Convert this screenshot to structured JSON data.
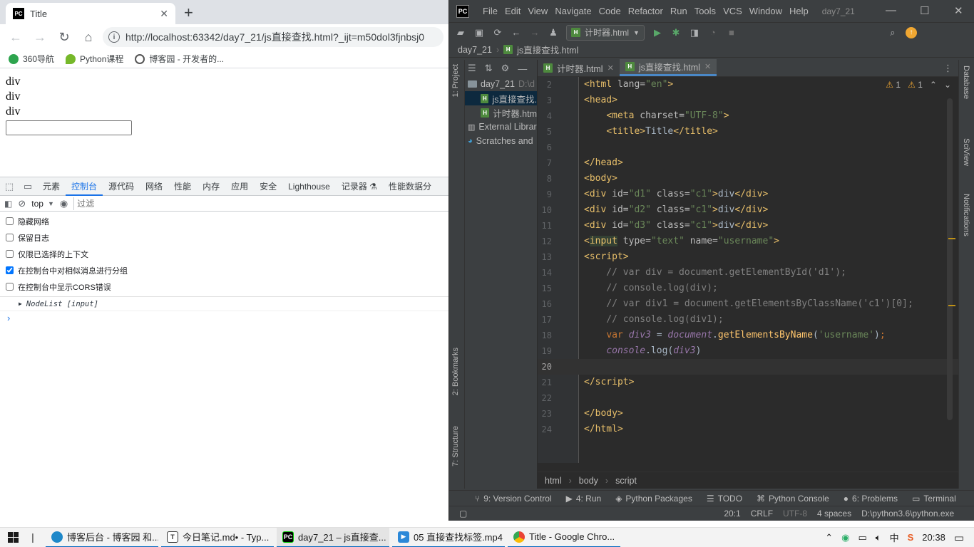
{
  "chrome": {
    "tab_title": "Title",
    "url": "http://localhost:63342/day7_21/js直接查找.html?_ijt=m50dol3fjnbsj0",
    "bookmarks": [
      "360导航",
      "Python课程",
      "博客园 - 开发者的..."
    ],
    "page": {
      "divs": [
        "div",
        "div",
        "div"
      ]
    },
    "devtools": {
      "tabs": [
        "元素",
        "控制台",
        "源代码",
        "网络",
        "性能",
        "内存",
        "应用",
        "安全",
        "Lighthouse",
        "记录器 ⚗",
        "性能数据分"
      ],
      "active_tab": "控制台",
      "context": "top",
      "filter_placeholder": "过滤",
      "settings": [
        {
          "label": "隐藏网络",
          "checked": false
        },
        {
          "label": "保留日志",
          "checked": false
        },
        {
          "label": "仅限已选择的上下文",
          "checked": false
        },
        {
          "label": "在控制台中对相似消息进行分组",
          "checked": true
        },
        {
          "label": "在控制台中显示CORS错误",
          "checked": false
        }
      ],
      "console_output": "NodeList [input]"
    }
  },
  "pycharm": {
    "menu": [
      "File",
      "Edit",
      "View",
      "Navigate",
      "Code",
      "Refactor",
      "Run",
      "Tools",
      "VCS",
      "Window",
      "Help"
    ],
    "project_title": "day7_21",
    "run_config": "计时器.html",
    "breadcrumb": [
      "day7_21",
      "js直接查找.html"
    ],
    "left_tabs": [
      "1: Project",
      "2: Bookmarks",
      "7: Structure"
    ],
    "right_tabs": [
      "Database",
      "SciView",
      "Notifications"
    ],
    "project_tree": [
      {
        "label": "day7_21",
        "extra": "D:\\d",
        "type": "folder",
        "indent": 0
      },
      {
        "label": "js直接查找.",
        "extra": "",
        "type": "html",
        "indent": 1,
        "selected": true
      },
      {
        "label": "计时器.htm",
        "extra": "",
        "type": "html",
        "indent": 1
      },
      {
        "label": "External Librar",
        "extra": "",
        "type": "lib",
        "indent": 0
      },
      {
        "label": "Scratches and",
        "extra": "",
        "type": "scratch",
        "indent": 0
      }
    ],
    "editor_tabs": [
      {
        "label": "计时器.html",
        "active": false
      },
      {
        "label": "js直接查找.html",
        "active": true
      }
    ],
    "warnings": {
      "warn1": "1",
      "warn2": "1"
    },
    "line_numbers": [
      "2",
      "3",
      "4",
      "5",
      "6",
      "7",
      "8",
      "9",
      "10",
      "11",
      "12",
      "13",
      "14",
      "15",
      "16",
      "17",
      "18",
      "19",
      "20",
      "21",
      "22",
      "23",
      "24"
    ],
    "current_line": "20",
    "code_crumbs": [
      "html",
      "body",
      "script"
    ],
    "bottom_tabs": [
      "9: Version Control",
      "4: Run",
      "Python Packages",
      "TODO",
      "Python Console",
      "6: Problems",
      "Terminal"
    ],
    "status": {
      "position": "20:1",
      "line_sep": "CRLF",
      "encoding": "UTF-8",
      "indent": "4 spaces",
      "interpreter": "D:\\python3.6\\python.exe"
    }
  },
  "taskbar": {
    "tasks": [
      "博客后台 - 博客园 和...",
      "今日笔记.md• - Typ...",
      "day7_21 – js直接查...",
      "05 直接查找标签.mp4",
      "Title - Google Chro..."
    ],
    "time": "20:38"
  },
  "colors": {
    "accent": "#1a73e8",
    "pycharm_bg": "#2b2b2b",
    "pycharm_chrome": "#3c3f41",
    "tag": "#e8bf6a",
    "string": "#6a8759",
    "keyword": "#cc7832"
  }
}
